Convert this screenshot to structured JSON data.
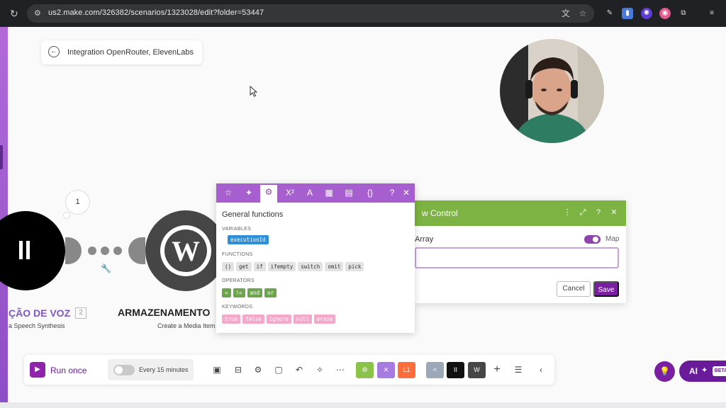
{
  "browser": {
    "url": "us2.make.com/326382/scenarios/1323028/edit?folder=53447",
    "icons": [
      "reload-icon",
      "site-info-icon",
      "translate-icon",
      "bookmark-star-icon",
      "eyedropper-icon",
      "docs-icon",
      "extension-icon",
      "profile-icon",
      "puzzle-icon",
      "media-controls-icon"
    ]
  },
  "scenario": {
    "name": "Integration OpenRouter, ElevenLabs"
  },
  "canvas": {
    "bubble_count": "1",
    "nodes": [
      {
        "title": "ÇÃO DE VOZ",
        "badge": "2",
        "subtitle": "a Speech Synthesis"
      },
      {
        "title": "ARMAZENAMENTO",
        "subtitle": "Create a Media Item"
      }
    ]
  },
  "function_picker": {
    "title": "General functions",
    "tabs": [
      "star-icon",
      "magic-icon",
      "gear-icon",
      "superscript-icon",
      "text-icon",
      "calendar-icon",
      "table-icon",
      "braces-icon",
      "help-icon",
      "close-icon"
    ],
    "variables_label": "VARIABLES",
    "variables": [
      "executionId"
    ],
    "functions_label": "FUNCTIONS",
    "functions": [
      "()",
      "get",
      "if",
      "ifempty",
      "switch",
      "omit",
      "pick"
    ],
    "operators_label": "OPERATORS",
    "operators": [
      "=",
      "!=",
      "and",
      "or"
    ],
    "keywords_label": "KEYWORDS",
    "keywords": [
      "true",
      "false",
      "ignore",
      "null",
      "erase"
    ]
  },
  "flow_control": {
    "title": "w Control",
    "field_label": "Array",
    "map_label": "Map",
    "map_enabled": true,
    "cancel_label": "Cancel",
    "save_label": "Save"
  },
  "toolbar": {
    "run_label": "Run once",
    "schedule_label": "Every 15 minutes",
    "module_badges": [
      "L1",
      "<",
      "II"
    ]
  },
  "ai": {
    "label": "AI",
    "beta": "BETA"
  },
  "colors": {
    "brand_purple": "#8e44ad",
    "flow_green": "#7cb342",
    "variable_blue": "#2f8fd6",
    "operator_green": "#6da64a",
    "keyword_pink": "#f3a9c9"
  }
}
